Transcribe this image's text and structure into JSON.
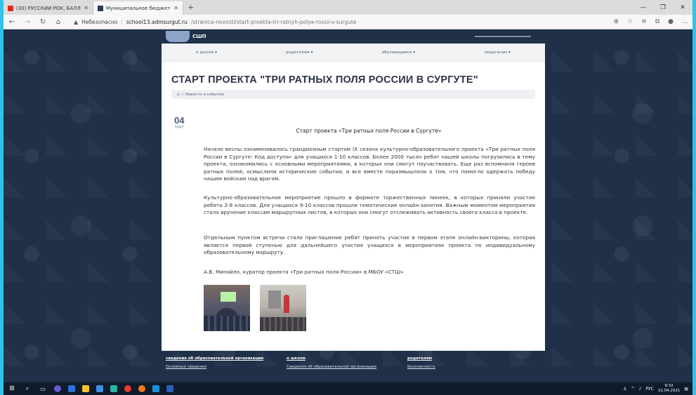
{
  "browser": {
    "tabs": [
      {
        "title": "(30) РУССКИЙ РОК, БАЛЛАДЫ",
        "active": false
      },
      {
        "title": "Муниципальное бюджетное о",
        "active": true
      }
    ],
    "new_tab": "+",
    "address": {
      "security_label": "Небезопасно",
      "host": "school13.admsurgut.ru",
      "path": "/stranica-novosti/start-proekta-tri-ratnyh-polya-rossii-v-surgute"
    }
  },
  "site": {
    "logo_text": "СШП",
    "nav": [
      {
        "label": "о школе ▾"
      },
      {
        "label": "родителям ▾"
      },
      {
        "label": "обучающимся ▾"
      },
      {
        "label": "педагогам ▾"
      }
    ],
    "page_title": "СТАРТ ПРОЕКТА \"ТРИ РАТНЫХ ПОЛЯ РОССИИ В СУРГУТЕ\"",
    "breadcrumb": {
      "separator": "/",
      "item": "Новости и события"
    },
    "date": {
      "day": "04",
      "month": "МАР"
    },
    "article": {
      "heading": "Старт проекта «Три ратных поля России в Сургуте»",
      "paragraphs": [
        "Начало весны ознаменовалось грандиозным стартом IX сезона культурно-образовательного проекта «Три ратных поля России в Сургуте: Код доступа» для учащихся 1-10 классов. Более 2000 тысяч ребят нашей школы погрузились в тему проекта, ознакомились с основными мероприятиями, в которых они смогут поучаствовать. Еще раз вспомнили героев ратных полей, осмыслили исторические события, и все вместе поразмышляли о том, что помогло одержать победу нашим войскам над врагом.",
        "Культурно-образовательное мероприятие прошло в формате торжественных линеек, в которых приняли участие ребята 2-8 классов. Для учащихся 9-10 классов прошли тематические онлайн-занятия. Важным моментом мероприятия стало вручение классам маршрутных листов, в которых они смогут отслеживать активность своего класса в проекте.",
        "Отдельным пунктом встречи стало приглашение ребят принять участие в первом этапе онлайн-викторины, которая является первой ступенью для дальнейшего участия учащихся в мероприятиях проекта по индивидуальному образовательному маршруту.",
        "А.В. Миняйло, куратор проекта «Три ратных поля России» в МБОУ «СТШ»"
      ]
    },
    "footer": [
      {
        "heading": "сведения об образовательной организации",
        "link": "Основные сведения"
      },
      {
        "heading": "о школе",
        "link": "Сведения об образовательной организации"
      },
      {
        "heading": "родителям",
        "link": "Безопасность"
      }
    ]
  },
  "taskbar": {
    "language": "РУС",
    "time": "9:32",
    "date": "22.04.2021"
  },
  "colors": {
    "site_background": "#1f3048",
    "content_background": "#ffffff",
    "title": "#2c3446",
    "taskbar": "#0f1a2b"
  }
}
